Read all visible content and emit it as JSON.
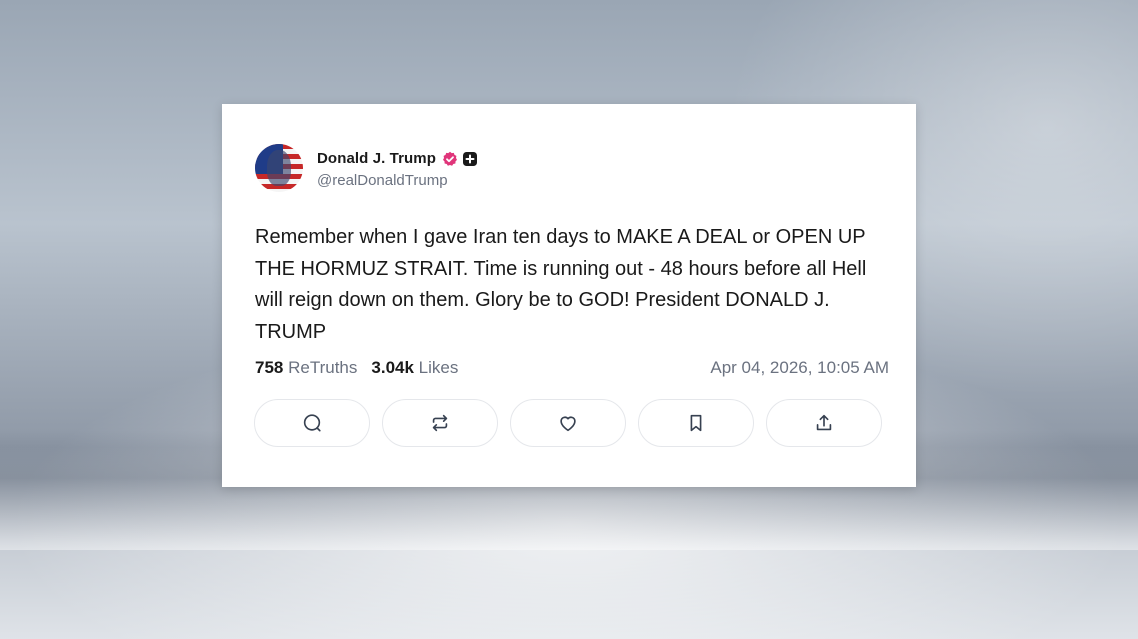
{
  "post": {
    "display_name": "Donald J. Trump",
    "handle": "@realDonaldTrump",
    "text": "Remember when I gave Iran ten days to MAKE A DEAL or OPEN UP THE HORMUZ STRAIT. Time is running out - 48 hours before all Hell will reign down on them. Glory be to GOD! President DONALD J. TRUMP",
    "retruths_count": "758",
    "retruths_label": "ReTruths",
    "likes_count": "3.04k",
    "likes_label": "Likes",
    "timestamp": "Apr 04, 2026, 10:05 AM"
  },
  "icons": {
    "avatar": "avatar-flag-portrait",
    "verified": "verified-badge-icon",
    "plus": "plus-badge-icon",
    "actions": [
      "reply-icon",
      "retruth-icon",
      "like-icon",
      "bookmark-icon",
      "share-icon"
    ]
  },
  "colors": {
    "verified_badge": "#e0357a",
    "text": "#1a1a1a",
    "muted": "#6b7280",
    "border": "#e5e7eb"
  }
}
